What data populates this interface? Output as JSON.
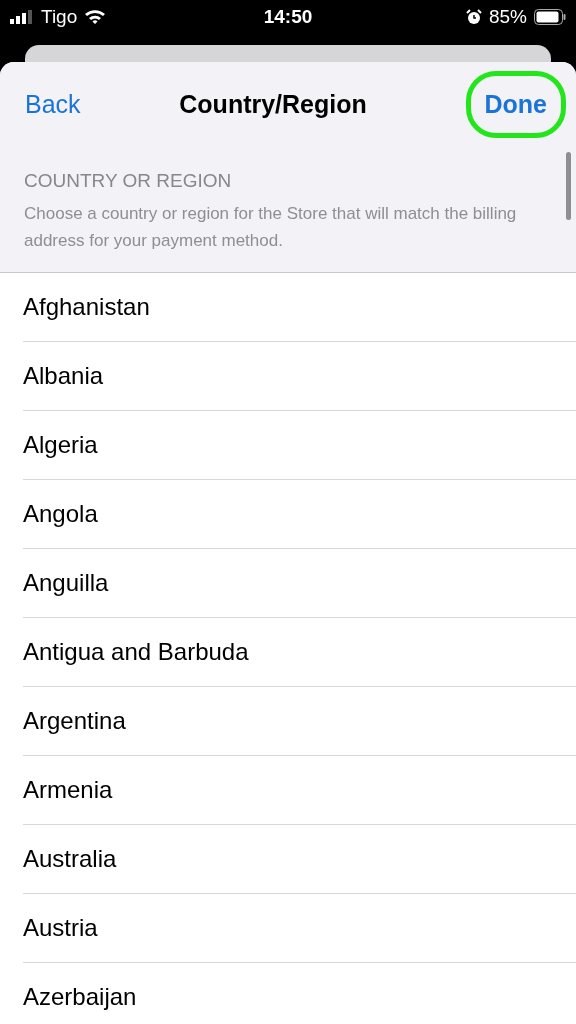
{
  "status_bar": {
    "carrier": "Tigo",
    "time": "14:50",
    "battery": "85%"
  },
  "nav": {
    "back": "Back",
    "title": "Country/Region",
    "done": {
      "label": "Done",
      "highlighted": true
    }
  },
  "section": {
    "header": "COUNTRY OR REGION",
    "description": "Choose a country or region for the Store that will match the billing address for your payment method."
  },
  "countries": [
    "Afghanistan",
    "Albania",
    "Algeria",
    "Angola",
    "Anguilla",
    "Antigua and Barbuda",
    "Argentina",
    "Armenia",
    "Australia",
    "Austria",
    "Azerbaijan"
  ]
}
